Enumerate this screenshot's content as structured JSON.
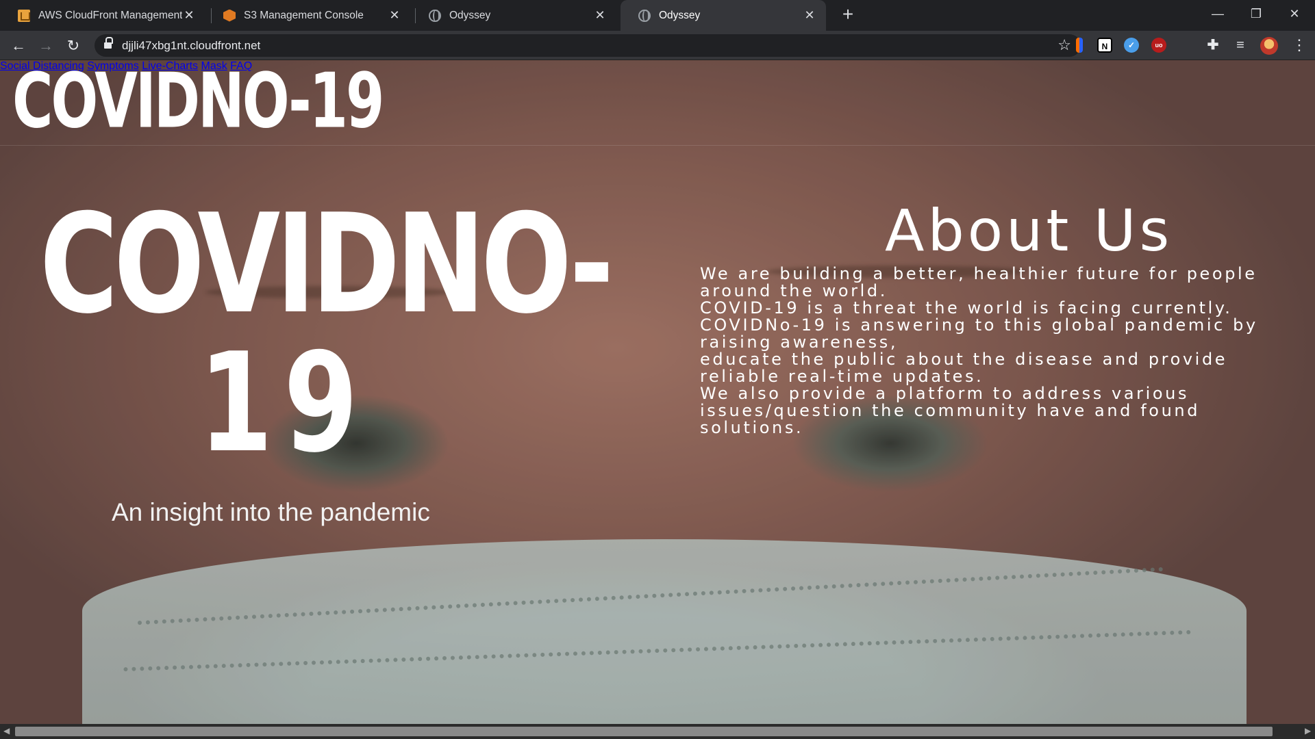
{
  "browser": {
    "tabs": [
      {
        "title": "AWS CloudFront Management Co",
        "icon": "aws-cube-icon",
        "active": false
      },
      {
        "title": "S3 Management Console",
        "icon": "s3-cube-icon",
        "active": false
      },
      {
        "title": "Odyssey",
        "icon": "globe-icon",
        "active": false
      },
      {
        "title": "Odyssey",
        "icon": "globe-icon",
        "active": true
      }
    ],
    "close_glyph": "✕",
    "new_tab_glyph": "+",
    "window": {
      "minimize": "—",
      "restore": "❐",
      "close": "✕"
    },
    "nav": {
      "back": "←",
      "forward": "→",
      "reload": "↻"
    },
    "url": "djjli47xbg1nt.cloudfront.net",
    "bookmark_glyph": "☆",
    "extensions": {
      "n_label": "N",
      "u_label": "uo",
      "c_label": "✓",
      "puzzle": "✚",
      "queue": "≡",
      "menu": "⋮"
    }
  },
  "site": {
    "logo": "COVIDNO-19",
    "nav": [
      "Social Distancing",
      "Symptoms",
      "Live-Charts",
      "Mask",
      "FAQ"
    ],
    "hero": {
      "line1": "COVIDNO-",
      "line2": "19",
      "tagline": "An insight into the pandemic"
    },
    "about": {
      "title": "About Us",
      "lines": [
        "We are building a better, healthier future for people around the world.",
        "COVID-19 is a threat the world is facing currently.",
        "COVIDNo-19 is answering to this global pandemic by raising awareness,",
        "educate the public about the disease and provide reliable real-time updates.",
        "We also provide a platform to address various issues/question the community have and found solutions."
      ]
    }
  },
  "scrollbar": {
    "left": "◀",
    "right": "▶"
  }
}
